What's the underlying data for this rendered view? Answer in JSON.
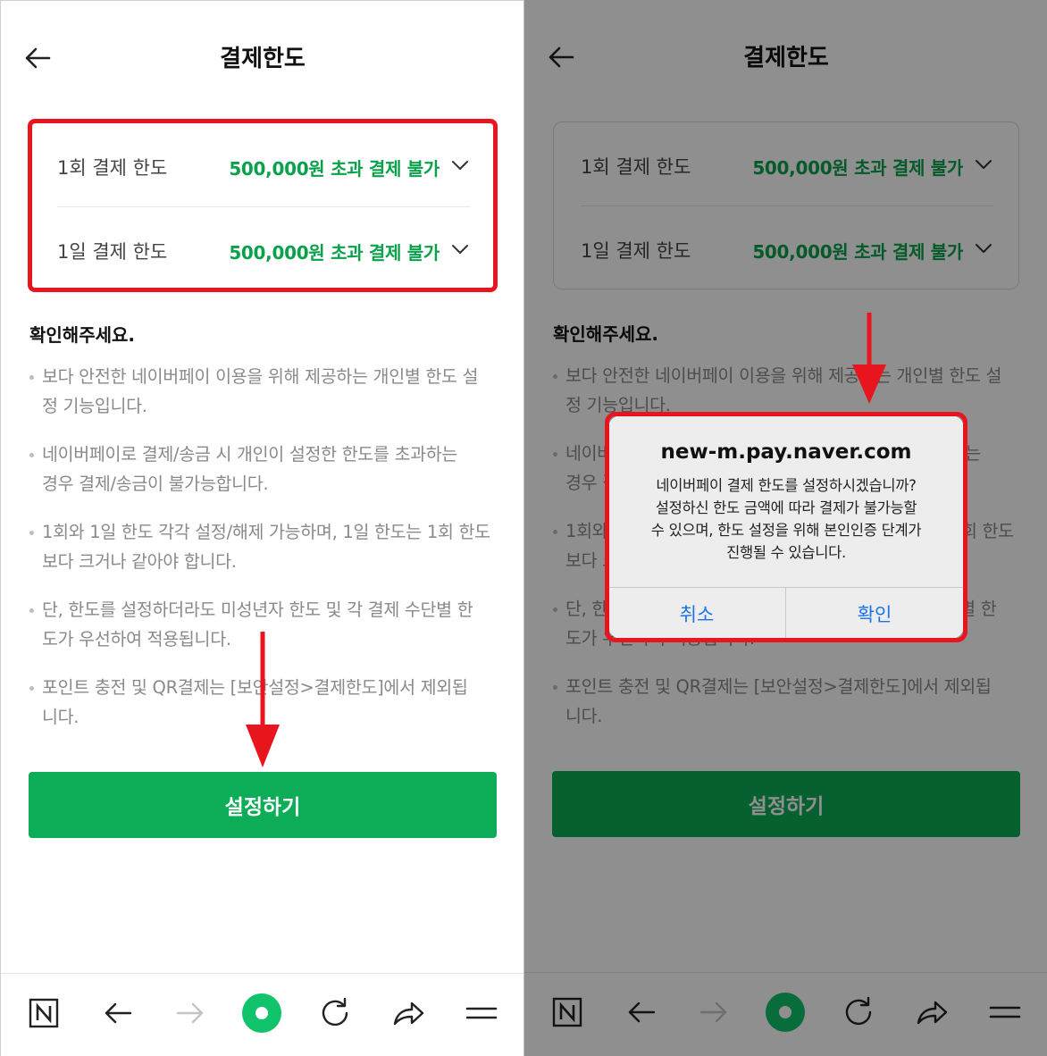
{
  "header": {
    "title": "결제한도"
  },
  "limits": [
    {
      "label": "1회 결제 한도",
      "value": "500,000원 초과 결제 불가"
    },
    {
      "label": "1일 결제 한도",
      "value": "500,000원 초과 결제 불가"
    }
  ],
  "notice": {
    "title": "확인해주세요.",
    "items": [
      {
        "line1": "보다 안전한 네이버페이 이용을 위해 제공하는 개인별 한도 설",
        "line2": "정 기능입니다."
      },
      {
        "line1": "네이버페이로 결제/송금 시 개인이 설정한 한도를 초과하는",
        "line2": "경우 결제/송금이 불가능합니다."
      },
      {
        "line1": "1회와 1일 한도 각각 설정/해제 가능하며, 1일 한도는 1회 한도",
        "line2": "보다 크거나 같아야 합니다."
      },
      {
        "line1": "단, 한도를 설정하더라도 미성년자 한도 및 각 결제 수단별 한",
        "line2": "도가 우선하여 적용됩니다."
      },
      {
        "line1": "포인트 충전 및 QR결제는 [보안설정>결제한도]에서 제외됩",
        "line2": "니다."
      }
    ]
  },
  "setup_button": "설정하기",
  "dialog": {
    "title": "new-m.pay.naver.com",
    "message": [
      "네이버페이 결제 한도를 설정하시겠습니까?",
      "설정하신 한도 금액에 따라 결제가 불가능할",
      "수 있으며, 한도 설정을 위해 본인인증 단계가",
      "진행될 수 있습니다."
    ],
    "cancel": "취소",
    "confirm": "확인"
  },
  "bottom_bar": {
    "icons": [
      "naver-n-icon",
      "back-arrow-icon",
      "forward-arrow-icon",
      "green-dot-icon",
      "refresh-icon",
      "share-icon",
      "menu-icon"
    ]
  },
  "colors": {
    "accent_green": "#0aa14b",
    "button_green": "#0dac57",
    "highlight_red": "#e8141e",
    "dialog_button_blue": "#1a73e8"
  }
}
